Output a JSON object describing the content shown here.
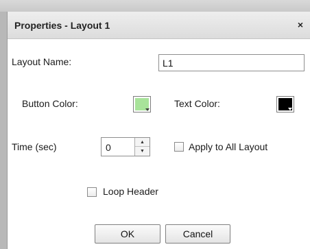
{
  "dialog": {
    "title": "Properties - Layout 1",
    "close_label": "×"
  },
  "fields": {
    "layout_name_label": "Layout Name:",
    "layout_name_value": "L1",
    "button_color_label": "Button Color:",
    "button_color": "#a8e39a",
    "text_color_label": "Text Color:",
    "text_color": "#000000",
    "time_label": "Time (sec)",
    "time_value": "0",
    "apply_all_label": "Apply to All Layout",
    "apply_all_checked": false,
    "loop_header_label": "Loop Header",
    "loop_header_checked": false
  },
  "buttons": {
    "ok_label": "OK",
    "cancel_label": "Cancel"
  },
  "icons": {
    "close": "close-icon",
    "spin_up": "spin-up-icon",
    "spin_down": "spin-down-icon",
    "color_dropdown": "dropdown-arrow-icon"
  }
}
